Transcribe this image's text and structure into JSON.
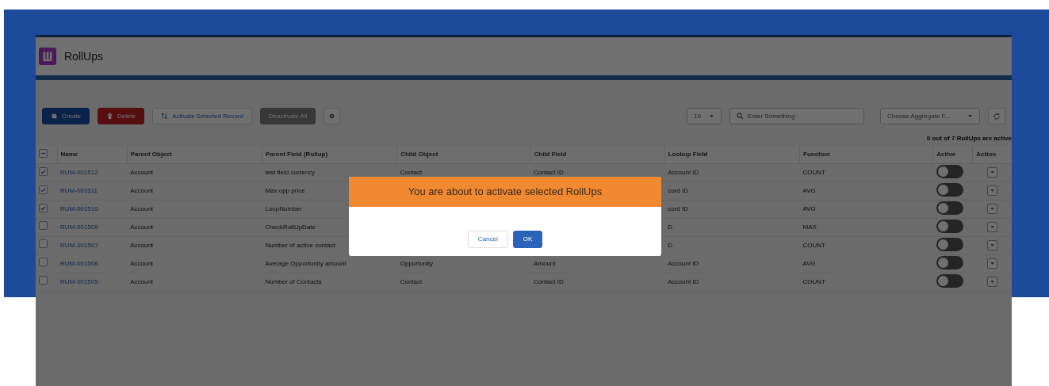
{
  "app": {
    "title": "RollUps"
  },
  "toolbar": {
    "buttons": [
      {
        "kind": "create",
        "label": "Create",
        "disabled": false
      },
      {
        "kind": "delete",
        "label": "Delete",
        "disabled": false
      },
      {
        "kind": "activate",
        "label": "Activate Selected Record",
        "disabled": false
      },
      {
        "kind": "deactivate",
        "label": "Deactivate All",
        "disabled": true
      },
      {
        "kind": "settings",
        "disabled": false
      }
    ],
    "page_size": "10",
    "search": {
      "placeholder": "Enter Something"
    },
    "aggregate": {
      "placeholder": "Choose Aggregate F..."
    }
  },
  "summary": "0 out of 7 RollUps are active",
  "table": {
    "header_checkbox": {
      "indeterminate": true
    },
    "columns": [
      "Name",
      "Parent Object",
      "Parent Field (Rollup)",
      "Child Object",
      "Child Field",
      "Lookup Field",
      "Function",
      "Active",
      "Action"
    ],
    "rows": [
      {
        "selected": true,
        "name": "RUM-001512",
        "parent_object": "Account",
        "parent_field": "test field currency",
        "child_object": "Contact",
        "child_field": "Contact ID",
        "lookup_field": "Account ID",
        "function": "COUNT",
        "active": false
      },
      {
        "selected": true,
        "name": "RUM-001511",
        "parent_object": "Account",
        "parent_field": "Max opp price",
        "lookup_field": "cord ID",
        "function": "AVG",
        "active": false
      },
      {
        "selected": true,
        "name": "RUM-001510",
        "parent_object": "Account",
        "parent_field": "LoopNumber",
        "lookup_field": "cord ID",
        "function": "AVG",
        "active": false
      },
      {
        "selected": false,
        "name": "RUM-001509",
        "parent_object": "Account",
        "parent_field": "CheckRollUpDate",
        "lookup_field": "D",
        "function": "MAX",
        "active": false
      },
      {
        "selected": false,
        "name": "RUM-001507",
        "parent_object": "Account",
        "parent_field": "Number of active contact",
        "lookup_field": "D",
        "function": "COUNT",
        "active": false
      },
      {
        "selected": false,
        "name": "RUM-001506",
        "parent_object": "Account",
        "parent_field": "Average Opportunity amount",
        "child_object": "Opportunity",
        "child_field": "Amount",
        "lookup_field": "Account ID",
        "function": "AVG",
        "active": false
      },
      {
        "selected": false,
        "name": "RUM-001505",
        "parent_object": "Account",
        "parent_field": "Number of Contacts",
        "child_object": "Contact",
        "child_field": "Contact ID",
        "lookup_field": "Account ID",
        "function": "COUNT",
        "active": false
      }
    ]
  },
  "modal": {
    "title": "You are about to activate selected RollUps",
    "buttons": [
      {
        "kind": "cancel",
        "label": "Cancel"
      },
      {
        "kind": "ok",
        "label": "OK"
      }
    ]
  }
}
